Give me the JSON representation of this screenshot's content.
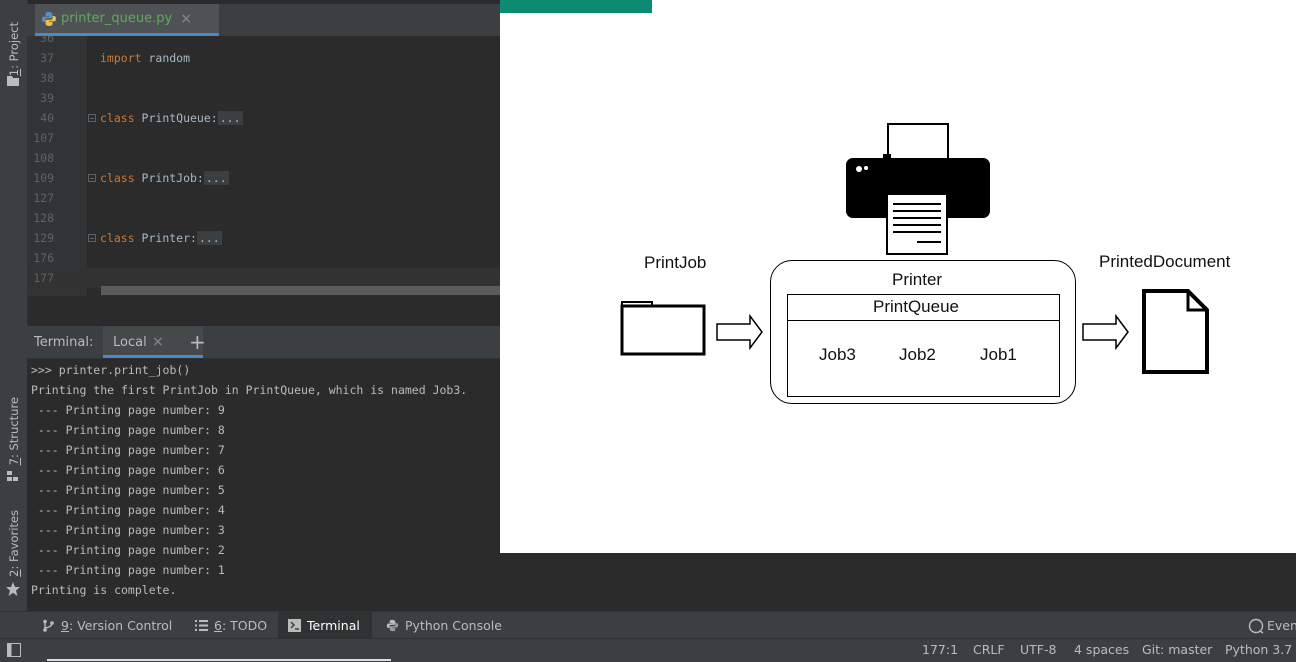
{
  "sidebar": {
    "project": {
      "mnemonic": "1",
      "label": ": Project"
    },
    "structure": {
      "mnemonic": "7",
      "label": ": Structure"
    },
    "favorites": {
      "mnemonic": "2",
      "label": ": Favorites"
    }
  },
  "editor": {
    "tab": {
      "filename": "printer_queue.py",
      "close": "×"
    },
    "lines": [
      {
        "num": "36",
        "code": ""
      },
      {
        "num": "37",
        "kw": "import",
        "rest": " random",
        "dots": ""
      },
      {
        "num": "38",
        "code": ""
      },
      {
        "num": "39",
        "code": ""
      },
      {
        "num": "40",
        "kw": "class",
        "rest": " PrintQueue:",
        "dots": "..."
      },
      {
        "num": "107",
        "code": ""
      },
      {
        "num": "108",
        "code": ""
      },
      {
        "num": "109",
        "kw": "class",
        "rest": " PrintJob:",
        "dots": "..."
      },
      {
        "num": "127",
        "code": ""
      },
      {
        "num": "128",
        "code": ""
      },
      {
        "num": "129",
        "kw": "class",
        "rest": " Printer:",
        "dots": "..."
      },
      {
        "num": "176",
        "code": ""
      },
      {
        "num": "177",
        "code": ""
      }
    ]
  },
  "terminal": {
    "title": "Terminal:",
    "tab_label": "Local",
    "tab_close": "×",
    "add": "+",
    "lines": [
      ">>> printer.print_job()",
      "Printing the first PrintJob in PrintQueue, which is named Job3.",
      " --- Printing page number: 9",
      " --- Printing page number: 8",
      " --- Printing page number: 7",
      " --- Printing page number: 6",
      " --- Printing page number: 5",
      " --- Printing page number: 4",
      " --- Printing page number: 3",
      " --- Printing page number: 2",
      " --- Printing page number: 1",
      "Printing is complete."
    ]
  },
  "toolwindows": [
    {
      "mnemonic": "9",
      "label": ": Version Control",
      "icon": "branch-icon"
    },
    {
      "mnemonic": "6",
      "label": ": TODO",
      "icon": "list-icon"
    },
    {
      "mnemonic": "",
      "label": "Terminal",
      "icon": "terminal-icon",
      "active": true
    },
    {
      "mnemonic": "",
      "label": "Python Console",
      "icon": "python-icon"
    }
  ],
  "event_log": "Even",
  "status": {
    "position": "177:1",
    "line_sep": "CRLF",
    "encoding": "UTF-8",
    "indent": "4 spaces",
    "vcs": "Git: master",
    "interpreter": "Python 3.7"
  },
  "diagram": {
    "printjob_label": "PrintJob",
    "printer_label": "Printer",
    "queue_label": "PrintQueue",
    "jobs": [
      "Job3",
      "Job2",
      "Job1"
    ],
    "printed_label": "PrintedDocument"
  },
  "colors": {
    "keyword": "#cc7832",
    "file_tab_text": "#62a85b",
    "accent_bar": "#0d8a72"
  }
}
